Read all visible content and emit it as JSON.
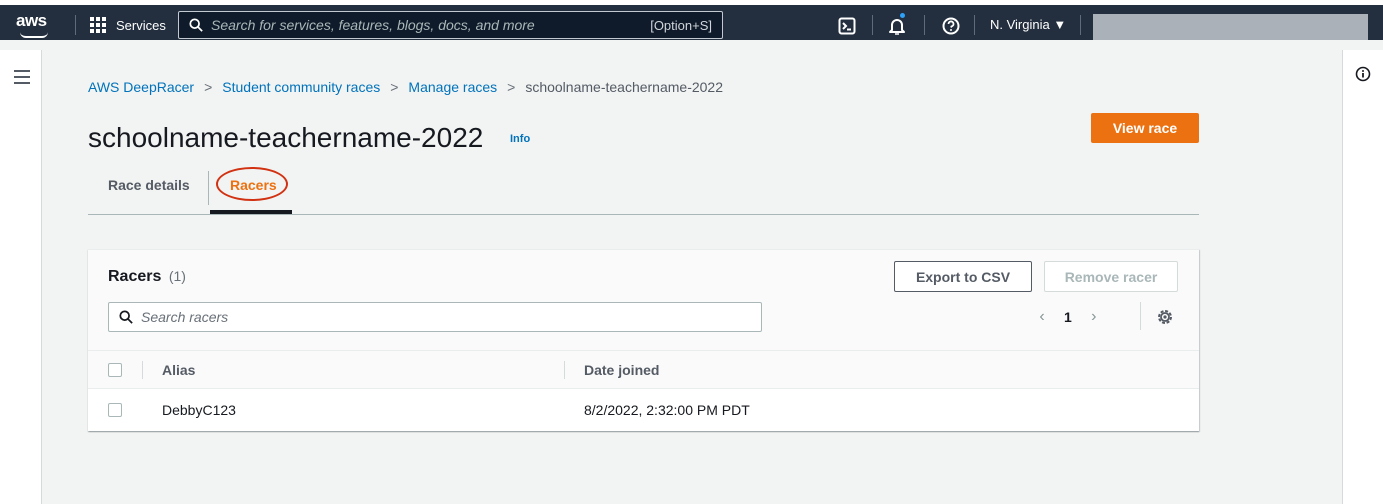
{
  "topnav": {
    "logo_text": "aws",
    "services_label": "Services",
    "search_placeholder": "Search for services, features, blogs, docs, and more",
    "search_shortcut": "[Option+S]",
    "region_label": "N. Virginia ▼"
  },
  "breadcrumb": {
    "items": [
      "AWS DeepRacer",
      "Student community races",
      "Manage races"
    ],
    "current": "schoolname-teachername-2022"
  },
  "page": {
    "title": "schoolname-teachername-2022",
    "info_label": "Info",
    "view_race_label": "View race"
  },
  "tabs": [
    {
      "label": "Race details",
      "active": false
    },
    {
      "label": "Racers",
      "active": true
    }
  ],
  "racers_panel": {
    "title": "Racers",
    "count": "(1)",
    "export_label": "Export to CSV",
    "remove_label": "Remove racer",
    "search_placeholder": "Search racers",
    "current_page": "1",
    "columns": [
      "Alias",
      "Date joined"
    ],
    "rows": [
      {
        "alias": "DebbyC123",
        "date_joined": "8/2/2022, 2:32:00 PM PDT"
      }
    ]
  },
  "colors": {
    "nav_bg": "#232f3e",
    "primary_button": "#ec7211",
    "link": "#0073bb",
    "highlight_ring": "#d13212"
  }
}
